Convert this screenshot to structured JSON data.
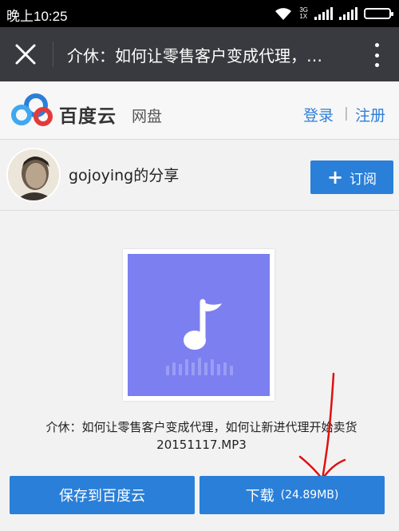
{
  "status_bar": {
    "time": "晚上10:25",
    "network_top": "3G",
    "network_bottom": "1X"
  },
  "title_bar": {
    "title": "介休：如何让零售客户变成代理，如何让新进代理开始卖货20151117.MP3"
  },
  "header": {
    "logo_text": "百度云",
    "pan_label": "网盘",
    "login": "登录",
    "separator": "|",
    "register": "注册"
  },
  "share": {
    "title": "gojoying的分享",
    "subscribe_label": "订阅",
    "subscribe_icon": "+"
  },
  "file": {
    "name": "介休：如何让零售客户变成代理，如何让新进代理开始卖货20151117.MP3",
    "thumb_color": "#7b7ff0"
  },
  "actions": {
    "save_label": "保存到百度云",
    "download_label": "下载",
    "download_size": "(24.89MB)"
  },
  "colors": {
    "accent": "#2a7fd8",
    "titlebar": "#393a3f",
    "annotation": "#e01010"
  }
}
